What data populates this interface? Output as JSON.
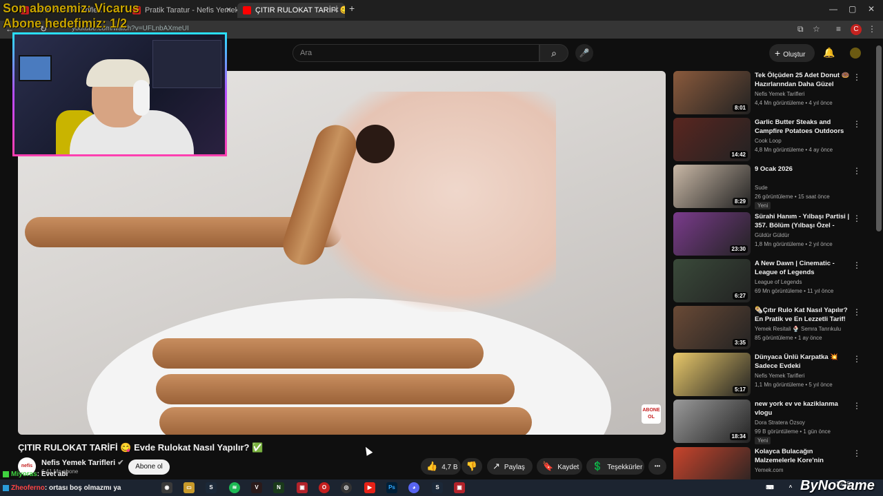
{
  "stream_overlay": {
    "line1": "Son abonemiz: Vicarus",
    "line2": "Abone hedefimiz: 1/2"
  },
  "browser": {
    "tabs": [
      {
        "label": "Nefis Yemek Tarifleri",
        "active": false
      },
      {
        "label": "Pratik Taratur - Nefis Yemek Ta",
        "active": false
      },
      {
        "label": "ÇITIR RULOKAT TARİFİ 😋",
        "active": true
      }
    ],
    "new_tab": "+",
    "url": "youtube.com/watch?v=UFLnbAXmeUI",
    "profile_letter": "C",
    "window_controls": [
      "—",
      "▢",
      "✕"
    ]
  },
  "youtube": {
    "search_placeholder": "Ara",
    "create_label": "Oluştur",
    "create_icon": "+"
  },
  "video": {
    "title": "ÇITIR RULOKAT TARİFİ 😋 Evde Rulokat Nasıl Yapılır? ✅",
    "channel": "Nefis Yemek Tarifleri",
    "channel_avatar_text": "nefis",
    "subscribers": "6,41 Mn abone",
    "subscribe_label": "Abone ol",
    "likes": "4,7 B",
    "share_label": "Paylaş",
    "save_label": "Kaydet",
    "thanks_label": "Teşekkürler",
    "more_label": "•••",
    "badge_text": "ABONE OL"
  },
  "recommendations": [
    {
      "title": "Tek Ölçüden 25 Adet Donut 🍩 Hazırlarından Daha Güzel Tam...",
      "channel": "Nefis Yemek Tarifleri",
      "meta": "4,4 Mn görüntüleme • 4 yıl önce",
      "duration": "8:01",
      "badge": "",
      "color": "#8a5a3c"
    },
    {
      "title": "Garlic Butter Steaks and Campfire Potatoes Outdoors",
      "channel": "Cook Loop",
      "meta": "4,8 Mn görüntüleme • 4 ay önce",
      "duration": "14:42",
      "badge": "",
      "color": "#5a2620"
    },
    {
      "title": "9 Ocak 2026",
      "channel": "Sude",
      "meta": "26 görüntüleme • 15 saat önce",
      "duration": "8:29",
      "badge": "Yeni",
      "color": "#c9b8a6"
    },
    {
      "title": "Sürahi Hanım - Yılbaşı Partisi | 357. Bölüm (Yılbaşı Özel - 2024)",
      "channel": "Güldür Güldür",
      "meta": "1,8 Mn görüntüleme • 2 yıl önce",
      "duration": "23:30",
      "badge": "",
      "color": "#7a3b8c"
    },
    {
      "title": "A New Dawn | Cinematic - League of Legends",
      "channel": "League of Legends",
      "meta": "69 Mn görüntüleme • 11 yıl önce",
      "duration": "6:27",
      "badge": "",
      "color": "#3a4a3a"
    },
    {
      "title": "🌯Çıtır Rulo Kat Nasıl Yapılır? En Pratik ve En Lezzetli Tarif!",
      "channel": "Yemek Resitali 🍨 Semra Tanrıkulu",
      "meta": "85 görüntüleme • 1 ay önce",
      "duration": "3:35",
      "badge": "",
      "color": "#6a4a36"
    },
    {
      "title": "Dünyaca Ünlü Karpatka 💥 Sadece Evdeki Malzemelerden...",
      "channel": "Nefis Yemek Tarifleri",
      "meta": "1,1 Mn görüntüleme • 5 yıl önce",
      "duration": "5:17",
      "badge": "",
      "color": "#e8c86a"
    },
    {
      "title": "new york ev ve kaziklanma vlogu",
      "channel": "Dora Stratera Özsoy",
      "meta": "99 B görüntüleme • 1 gün önce",
      "duration": "18:34",
      "badge": "Yeni",
      "color": "#9a9a9a"
    },
    {
      "title": "Kolayca Bulacağın Malzemelerle Kore'nin Meşhur...",
      "channel": "Yemek.com",
      "meta": "",
      "duration": "",
      "badge": "",
      "color": "#c8442c"
    }
  ],
  "chat": [
    {
      "user": "Miyoras",
      "message": ": Evet abi"
    },
    {
      "user": "Zheoferno",
      "message": ": ortası boş olmazmı ya"
    }
  ],
  "watermark": "ByNoGame",
  "clock": "19:15",
  "colors": {
    "youtube_red": "#ff0000",
    "overlay_gold": "#c8a400",
    "chat_user_green": "#3fd13f",
    "chat_user_red": "#ff4444"
  }
}
